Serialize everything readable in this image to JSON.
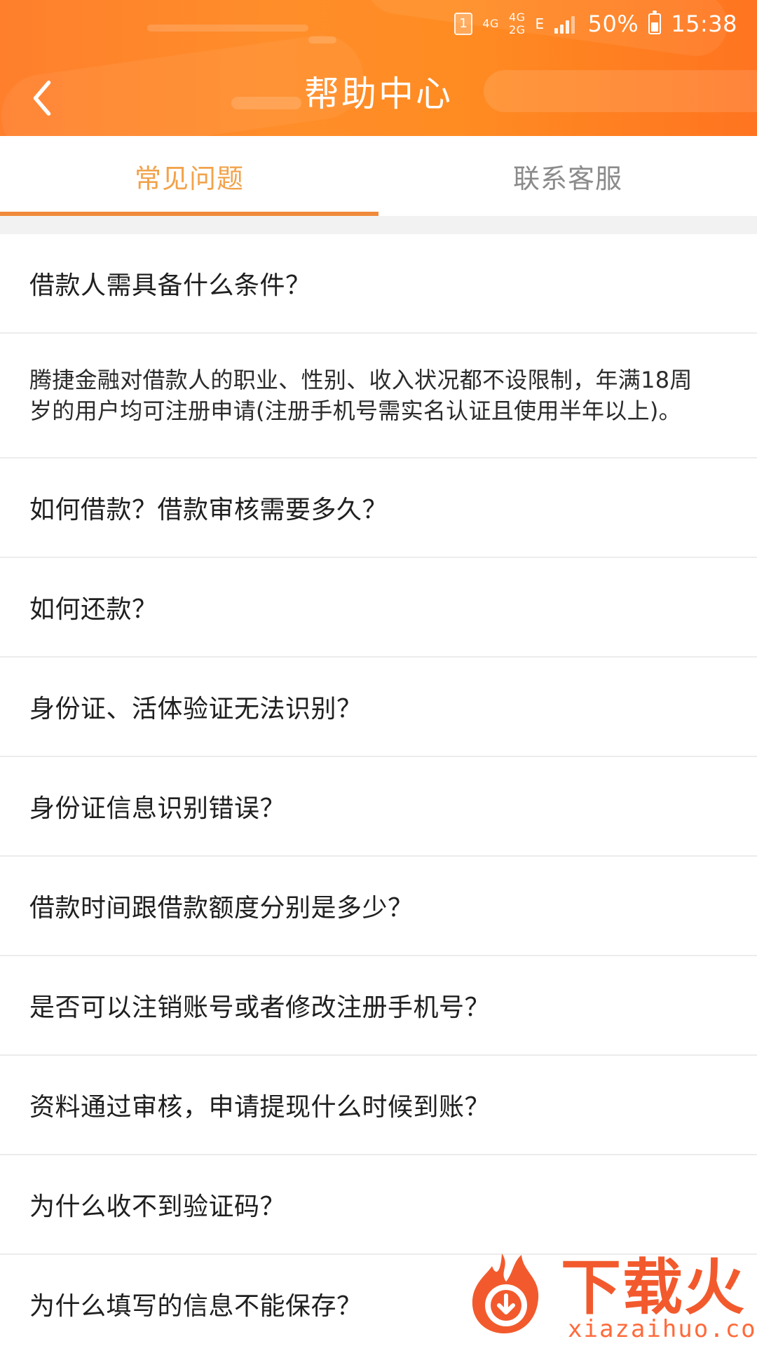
{
  "status_bar": {
    "sim": "1",
    "net_1": "4G",
    "net_2a": "4G",
    "net_2b": "2G",
    "edge": "E",
    "battery_percent": "50%",
    "time": "15:38"
  },
  "header": {
    "title": "帮助中心"
  },
  "tabs": [
    {
      "label": "常见问题",
      "active": true
    },
    {
      "label": "联系客服",
      "active": false
    }
  ],
  "faq": {
    "items": [
      {
        "question": "借款人需具备什么条件？"
      },
      {
        "answer": "腾捷金融对借款人的职业、性别、收入状况都不设限制，年满18周岁的用户均可注册申请(注册手机号需实名认证且使用半年以上)。"
      },
      {
        "question": "如何借款？借款审核需要多久？"
      },
      {
        "question": "如何还款？"
      },
      {
        "question": "身份证、活体验证无法识别？"
      },
      {
        "question": "身份证信息识别错误？"
      },
      {
        "question": "借款时间跟借款额度分别是多少？"
      },
      {
        "question": "是否可以注销账号或者修改注册手机号？"
      },
      {
        "question": "资料通过审核，申请提现什么时候到账？"
      },
      {
        "question": "为什么收不到验证码？"
      },
      {
        "question": "为什么填写的信息不能保存？"
      }
    ]
  },
  "watermark": {
    "brand": "下载火",
    "url": "xiazaihuo.com"
  },
  "colors": {
    "header_orange": "#ff8a2b",
    "tab_active": "#f2a34c",
    "tab_inactive": "#8b8b8b",
    "divider": "#ececec",
    "section_bg": "#f2f2f2",
    "text": "#1f1f1f",
    "watermark": "#f25a2d"
  }
}
